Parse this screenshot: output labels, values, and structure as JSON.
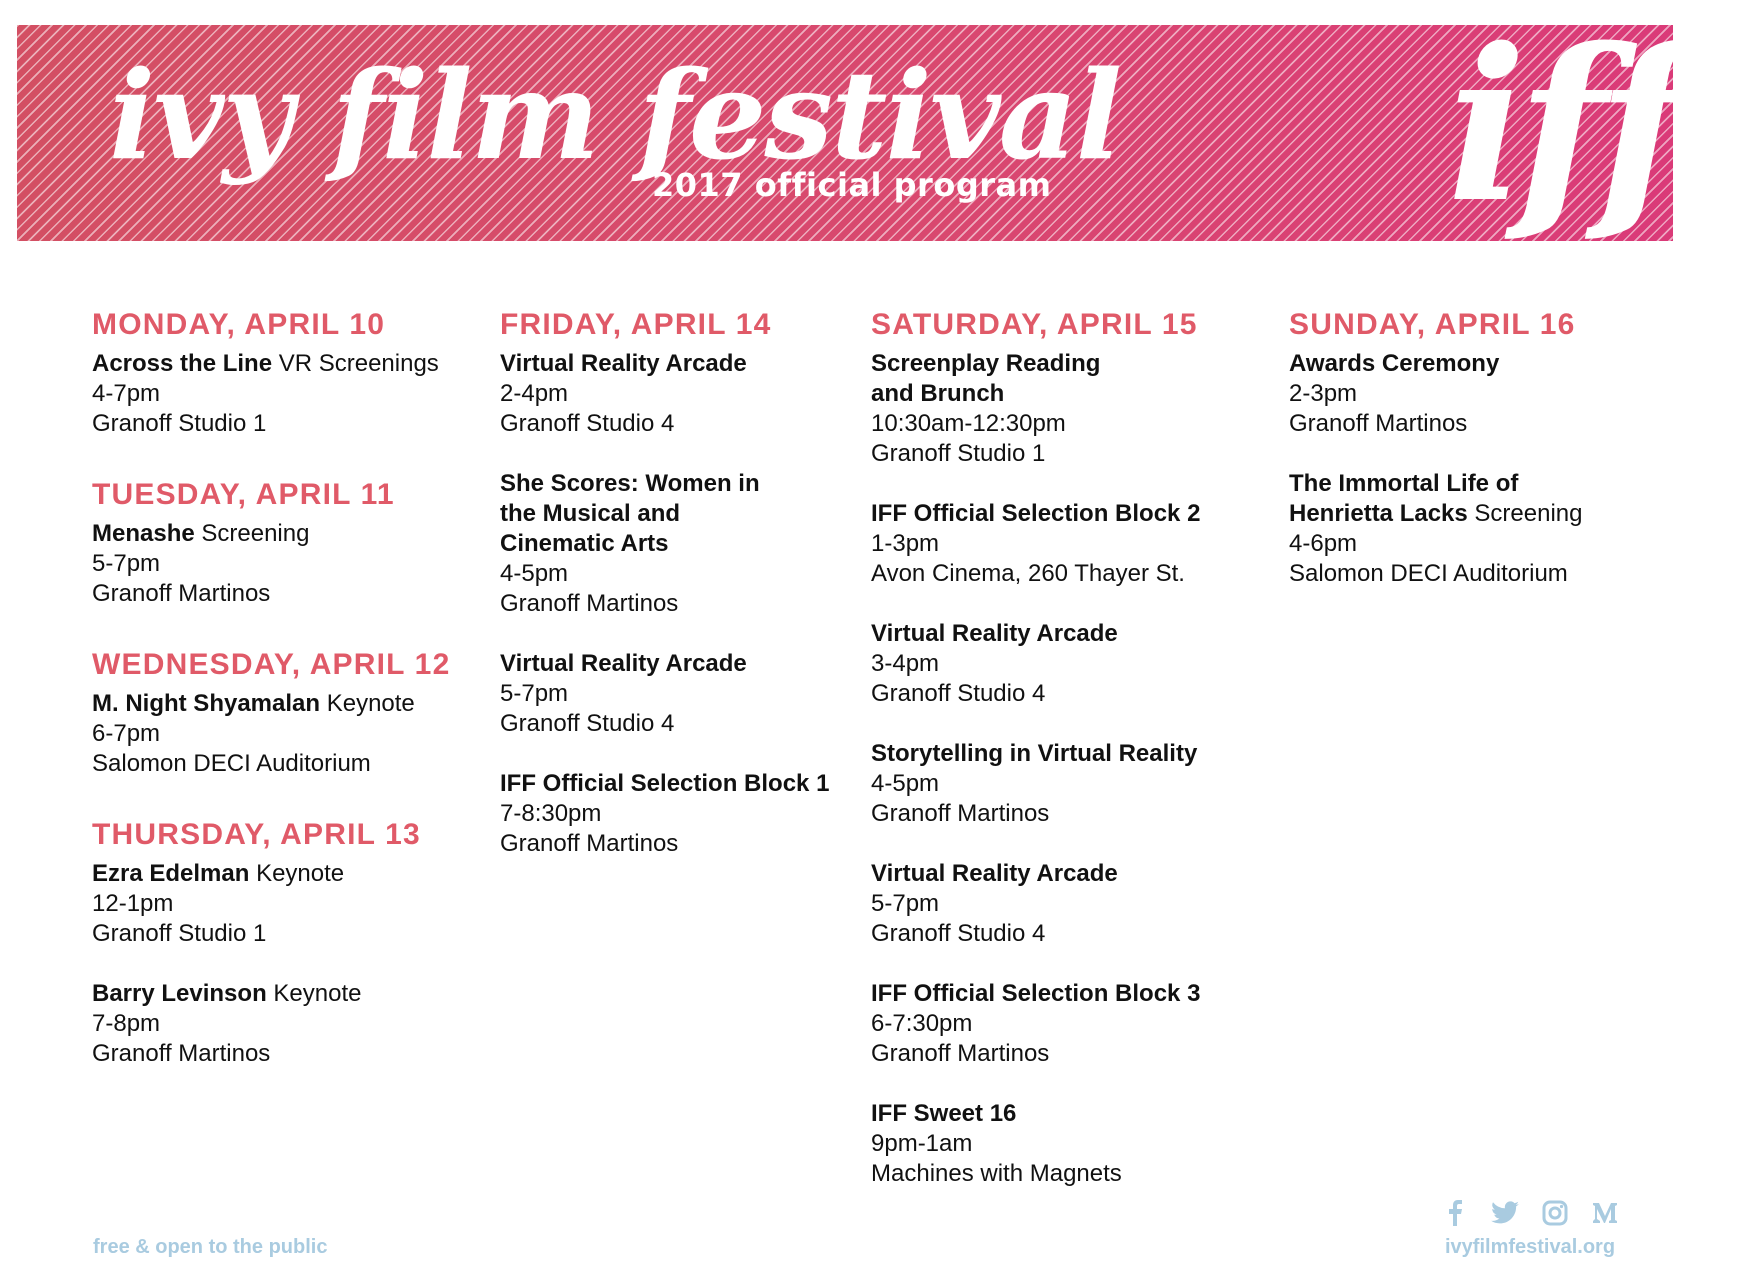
{
  "banner": {
    "title": "ivy film festival",
    "subtitle": "2017 official program",
    "monogram": "iff"
  },
  "columns": [
    {
      "days": [
        {
          "title": "MONDAY, APRIL 10",
          "events": [
            {
              "title": "Across the Line",
              "suffix": " VR Screenings",
              "time": "4-7pm",
              "location": "Granoff Studio 1"
            }
          ]
        },
        {
          "title": "TUESDAY, APRIL 11",
          "events": [
            {
              "title": "Menashe",
              "suffix": " Screening",
              "time": "5-7pm",
              "location": "Granoff Martinos"
            }
          ]
        },
        {
          "title": "WEDNESDAY, APRIL 12",
          "events": [
            {
              "title": "M. Night Shyamalan",
              "suffix": " Keynote",
              "time": "6-7pm",
              "location": "Salomon DECI Auditorium"
            }
          ]
        },
        {
          "title": "THURSDAY, APRIL 13",
          "events": [
            {
              "title": "Ezra Edelman",
              "suffix": " Keynote",
              "time": "12-1pm",
              "location": "Granoff Studio 1"
            },
            {
              "title": "Barry Levinson",
              "suffix": " Keynote",
              "time": "7-8pm",
              "location": "Granoff Martinos"
            }
          ]
        }
      ]
    },
    {
      "days": [
        {
          "title": "FRIDAY, APRIL 14",
          "events": [
            {
              "title": "Virtual Reality Arcade",
              "time": "2-4pm",
              "location": "Granoff Studio 4"
            },
            {
              "title_lines": [
                "She Scores: Women in",
                "the Musical and",
                "Cinematic Arts"
              ],
              "time": "4-5pm",
              "location": "Granoff Martinos"
            },
            {
              "title": "Virtual Reality Arcade",
              "time": "5-7pm",
              "location": "Granoff Studio 4"
            },
            {
              "title": "IFF Official Selection Block 1",
              "time": "7-8:30pm",
              "location": "Granoff Martinos"
            }
          ]
        }
      ]
    },
    {
      "days": [
        {
          "title": "SATURDAY, APRIL 15",
          "events": [
            {
              "title_lines": [
                "Screenplay Reading",
                "and Brunch"
              ],
              "time": "10:30am-12:30pm",
              "location": "Granoff Studio 1"
            },
            {
              "title": "IFF Official Selection Block 2",
              "time": "1-3pm",
              "location": "Avon Cinema, 260 Thayer St."
            },
            {
              "title": "Virtual Reality Arcade",
              "time": "3-4pm",
              "location": "Granoff Studio 4"
            },
            {
              "title": "Storytelling in Virtual Reality",
              "time": "4-5pm",
              "location": "Granoff Martinos"
            },
            {
              "title": "Virtual Reality Arcade",
              "time": "5-7pm",
              "location": "Granoff Studio 4"
            },
            {
              "title": "IFF Official Selection Block 3",
              "time": "6-7:30pm",
              "location": "Granoff Martinos"
            },
            {
              "title": "IFF Sweet 16",
              "time": "9pm-1am",
              "location": "Machines with Magnets"
            }
          ]
        }
      ]
    },
    {
      "days": [
        {
          "title": "SUNDAY, APRIL 16",
          "events": [
            {
              "title": "Awards Ceremony",
              "time": "2-3pm",
              "location": "Granoff Martinos"
            },
            {
              "title_lines": [
                "The Immortal Life of",
                "Henrietta Lacks"
              ],
              "suffix": " Screening",
              "time": "4-6pm",
              "location": "Salomon DECI Auditorium"
            }
          ]
        }
      ]
    }
  ],
  "footer": {
    "tagline": "free & open to the public",
    "website": "ivyfilmfestival.org",
    "social_icons": [
      "facebook-icon",
      "twitter-icon",
      "instagram-icon",
      "medium-icon"
    ],
    "icon_color": "#a9cbe0"
  },
  "colors": {
    "day_heading": "#e05a68",
    "banner_pink": "#d9486f"
  }
}
